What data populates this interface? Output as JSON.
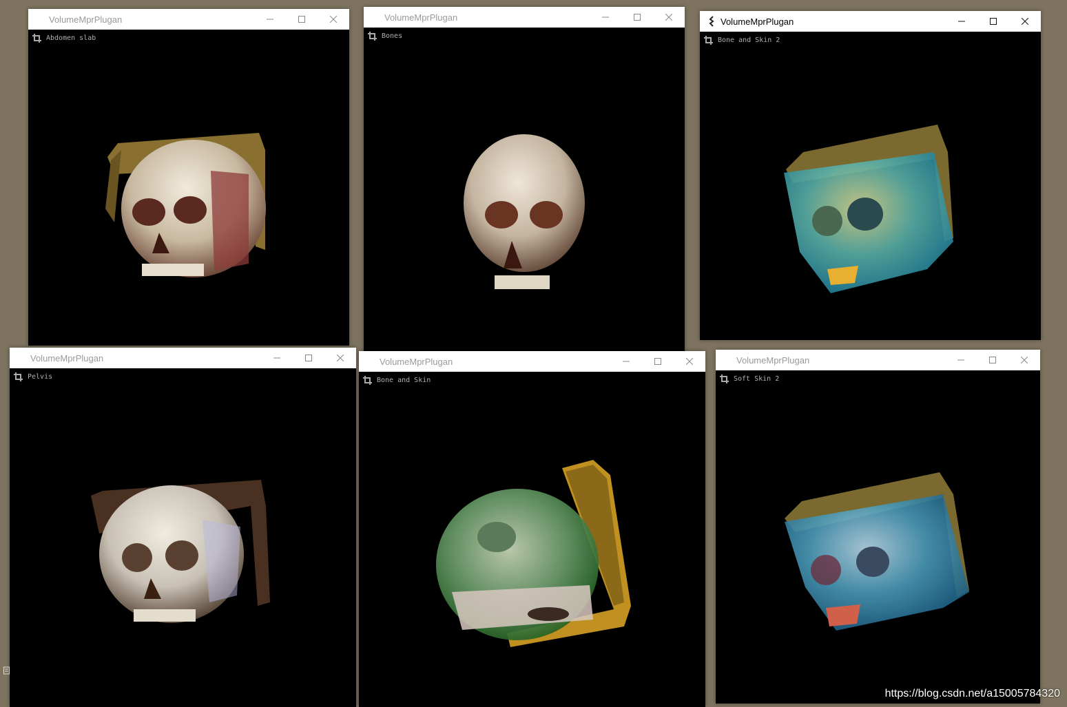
{
  "windows": [
    {
      "title": "VolumeMprPlugan",
      "preset": "Abdomen slab"
    },
    {
      "title": "VolumeMprPlugan",
      "preset": "Bones"
    },
    {
      "title": "VolumeMprPlugan",
      "preset": "Bone and Skin 2"
    },
    {
      "title": "VolumeMprPlugan",
      "preset": "Pelvis"
    },
    {
      "title": "VolumeMprPlugan",
      "preset": "Bone and Skin"
    },
    {
      "title": "VolumeMprPlugan",
      "preset": "Soft Skin 2"
    }
  ],
  "icons": {
    "app": "app-icon",
    "preset": "crop-icon",
    "minimize": "minimize-icon",
    "maximize": "maximize-icon",
    "close": "close-icon"
  },
  "colors": {
    "desktop": "#7d735f",
    "viewport": "#000000",
    "titlebar": "#ffffff"
  },
  "watermark": "https://blog.csdn.net/a15005784320"
}
